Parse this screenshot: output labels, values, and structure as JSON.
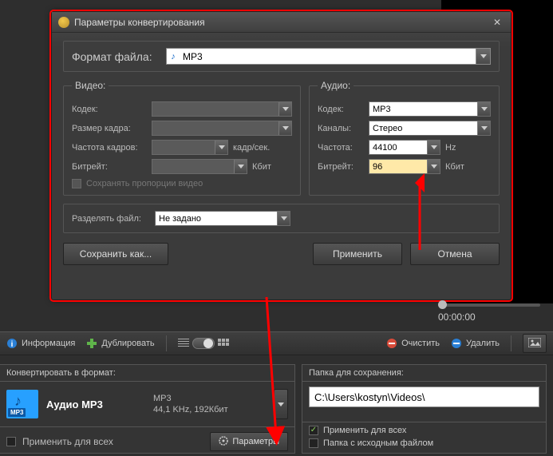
{
  "dialog": {
    "title": "Параметры конвертирования",
    "formatLabel": "Формат файла:",
    "formatValue": "MP3",
    "video": {
      "legend": "Видео:",
      "codec_label": "Кодек:",
      "framesize_label": "Размер кадра:",
      "framerate_label": "Частота кадров:",
      "framerate_unit": "кадр/сек.",
      "bitrate_label": "Битрейт:",
      "bitrate_unit": "Кбит",
      "keep_aspect": "Сохранять пропорции видео"
    },
    "audio": {
      "legend": "Аудио:",
      "codec_label": "Кодек:",
      "codec_value": "MP3",
      "channels_label": "Каналы:",
      "channels_value": "Стерео",
      "freq_label": "Частота:",
      "freq_value": "44100",
      "freq_unit": "Hz",
      "bitrate_label": "Битрейт:",
      "bitrate_value": "96",
      "bitrate_unit": "Кбит"
    },
    "split_label": "Разделять файл:",
    "split_value": "Не задано",
    "saveas": "Сохранить как...",
    "apply": "Применить",
    "cancel": "Отмена"
  },
  "player": {
    "time": "00:00:00"
  },
  "toolbar": {
    "info": "Информация",
    "duplicate": "Дублировать",
    "clear": "Очистить",
    "delete": "Удалить"
  },
  "leftPanel": {
    "head": "Конвертировать в формат:",
    "title": "Аудио MP3",
    "codec": "MP3",
    "spec": "44,1 KHz, 192Кбит",
    "apply_all": "Применить для всех",
    "params_btn": "Параметры"
  },
  "rightPanel": {
    "head": "Папка для сохранения:",
    "path": "C:\\Users\\kostyn\\Videos\\",
    "apply_all": "Применить для всех",
    "same_folder": "Папка с исходным файлом"
  }
}
